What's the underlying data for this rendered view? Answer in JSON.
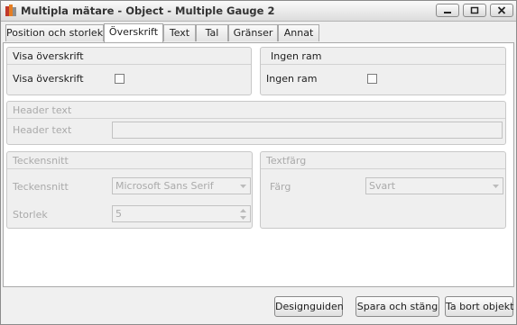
{
  "window": {
    "title": "Multipla mätare - Object - Multiple Gauge 2"
  },
  "tabs": [
    {
      "label": "Position och storlek"
    },
    {
      "label": "Överskrift",
      "active": true
    },
    {
      "label": "Text"
    },
    {
      "label": "Tal"
    },
    {
      "label": "Gränser"
    },
    {
      "label": "Annat"
    }
  ],
  "groups": {
    "show_header": {
      "title": "Visa överskrift",
      "label": "Visa överskrift",
      "checked": false
    },
    "no_frame": {
      "title": "Ingen ram",
      "label": "Ingen ram",
      "checked": false
    },
    "header_text": {
      "title": "Header text",
      "label": "Header text",
      "value": ""
    },
    "font": {
      "title": "Teckensnitt",
      "font_label": "Teckensnitt",
      "font_value": "Microsoft Sans Serif",
      "size_label": "Storlek",
      "size_value": "5"
    },
    "text_color": {
      "title": "Textfärg",
      "label": "Färg",
      "value": "Svart"
    }
  },
  "buttons": {
    "design_guide": "Designguiden",
    "save_close": "Spara och stäng",
    "delete_object": "Ta bort objekt"
  },
  "icons": {
    "app": "app-icon",
    "minimize": "minimize-icon",
    "maximize": "maximize-icon",
    "close": "close-icon"
  }
}
